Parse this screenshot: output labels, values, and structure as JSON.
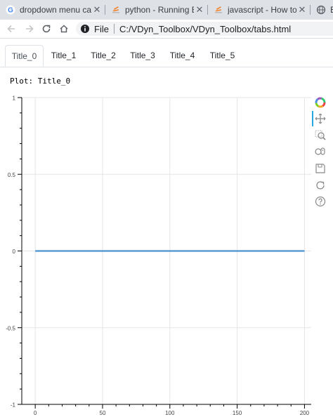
{
  "browser": {
    "tabs": [
      {
        "title": "dropdown menu callbac",
        "icon": "google-icon"
      },
      {
        "title": "python - Running Boke",
        "icon": "stackoverflow-icon"
      },
      {
        "title": "javascript - How to upd",
        "icon": "stackoverflow-icon"
      },
      {
        "title": "Bo",
        "icon": "globe-icon"
      }
    ],
    "address": {
      "scheme_label": "File",
      "path": "C:/VDyn_Toolbox/VDyn_Toolbox/tabs.html"
    }
  },
  "page": {
    "tabs": [
      {
        "label": "Title_0",
        "active": true
      },
      {
        "label": "Title_1",
        "active": false
      },
      {
        "label": "Title_2",
        "active": false
      },
      {
        "label": "Title_3",
        "active": false
      },
      {
        "label": "Title_4",
        "active": false
      },
      {
        "label": "Title_5",
        "active": false
      }
    ],
    "plot_label": "Plot: Title_0"
  },
  "toolbar": {
    "tools": [
      {
        "name": "bokeh-logo-icon",
        "active": false
      },
      {
        "name": "pan-icon",
        "active": true
      },
      {
        "name": "box-zoom-icon",
        "active": false
      },
      {
        "name": "wheel-zoom-icon",
        "active": false
      },
      {
        "name": "save-icon",
        "active": false
      },
      {
        "name": "reset-icon",
        "active": false
      },
      {
        "name": "help-icon",
        "active": false
      }
    ]
  },
  "colors": {
    "line": "#5b9bd5",
    "grid": "#e5e5e5",
    "active_tab_bg": "#ffffff",
    "tabstrip_bg": "#dee1e6"
  },
  "chart_data": {
    "type": "line",
    "x": [
      0,
      200
    ],
    "series": [
      {
        "values": [
          0,
          0
        ]
      }
    ],
    "xlim": [
      -10,
      205
    ],
    "ylim": [
      -1,
      1
    ],
    "xticks": [
      0,
      50,
      100,
      150,
      200
    ],
    "yticks": [
      -1,
      -0.5,
      0,
      0.5,
      1
    ],
    "xtick_labels": [
      "0",
      "50",
      "100",
      "150",
      "200"
    ],
    "ytick_labels": [
      "-1",
      "-0.5",
      "0",
      "0.5",
      "1"
    ],
    "grid": true,
    "title": "",
    "xlabel": "",
    "ylabel": ""
  }
}
